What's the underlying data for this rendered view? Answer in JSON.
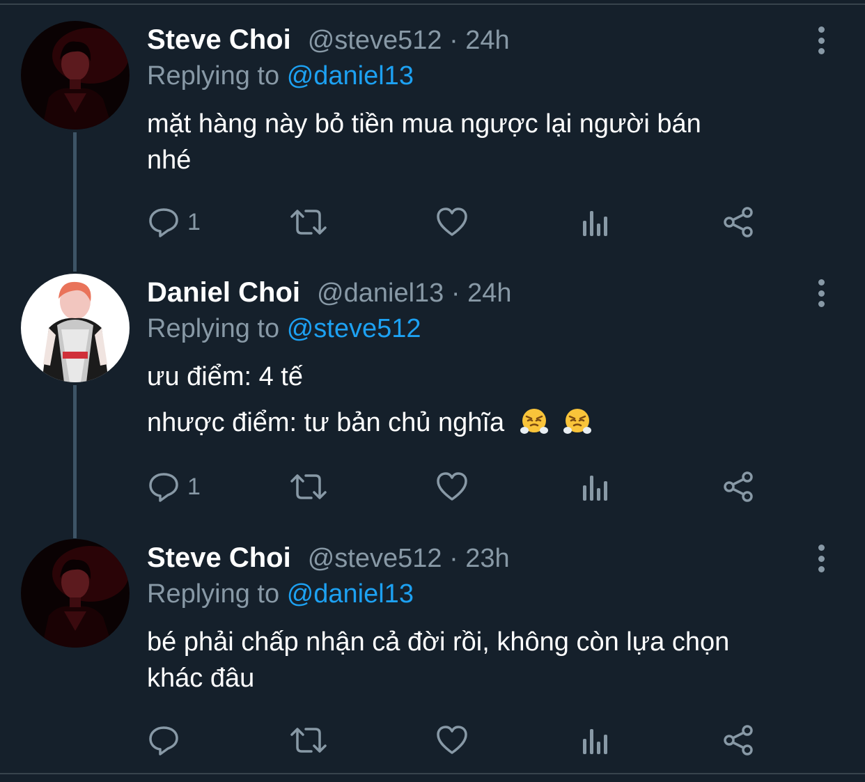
{
  "tweets": [
    {
      "name": "Steve Choi",
      "meta": "@steve512 · 24h",
      "replying_prefix": "Replying to",
      "replying_handle": "@daniel13",
      "lines": [
        "mặt hàng này bỏ tiền mua ngược lại người bán",
        "nhé"
      ],
      "reply_count": "1"
    },
    {
      "name": "Daniel Choi",
      "meta": "@daniel13 · 24h",
      "replying_prefix": "Replying to",
      "replying_handle": "@steve512",
      "lines": [
        "ưu điểm: 4 tế",
        "nhược điểm: tư bản chủ nghĩa"
      ],
      "reply_count": "1"
    },
    {
      "name": "Steve Choi",
      "meta": "@steve512 · 23h",
      "replying_prefix": "Replying to",
      "replying_handle": "@daniel13",
      "lines": [
        "bé phải chấp nhận cả đời rồi, không còn lựa chọn",
        "khác đâu"
      ],
      "reply_count": ""
    }
  ],
  "icons": {
    "reply": "reply-icon",
    "retweet": "retweet-icon",
    "like": "heart-icon",
    "analytics": "analytics-icon",
    "share": "share-icon",
    "more": "more-icon",
    "emoji": "face-with-steam-emoji"
  },
  "colors": {
    "background": "#15202b",
    "text": "#ffffff",
    "secondary": "#8899a6",
    "link": "#1da1f2",
    "thread_line": "#3d5466"
  }
}
